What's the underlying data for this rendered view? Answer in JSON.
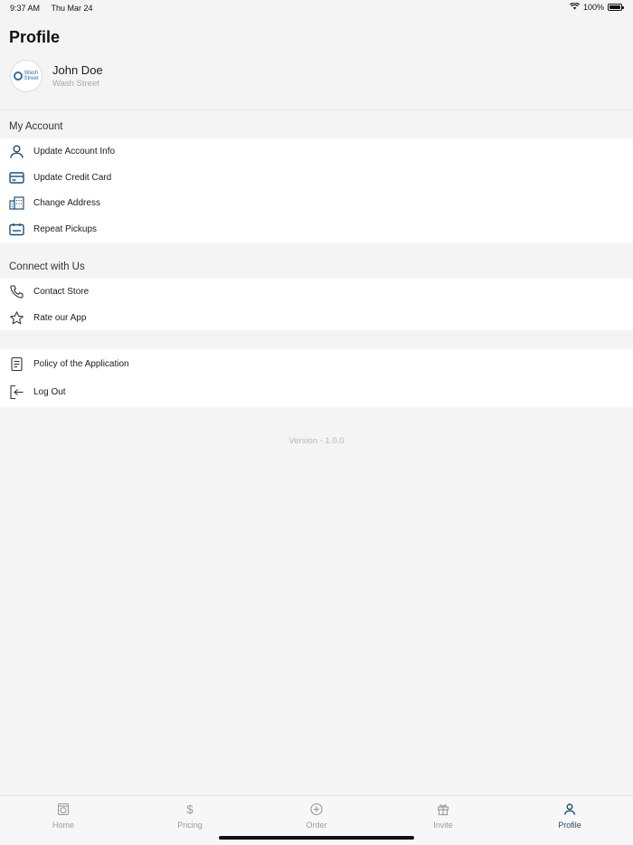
{
  "status_bar": {
    "time": "9:37 AM",
    "date": "Thu Mar 24",
    "battery": "100%"
  },
  "header": {
    "title": "Profile"
  },
  "profile": {
    "name": "John Doe",
    "subtitle": "Wash Street",
    "logo_text_line1": "Wash",
    "logo_text_line2": "Street"
  },
  "my_account": {
    "title": "My Account",
    "items": [
      {
        "label": "Update Account Info",
        "icon": "user-icon"
      },
      {
        "label": "Update Credit Card",
        "icon": "credit-card-icon"
      },
      {
        "label": "Change Address",
        "icon": "building-icon"
      },
      {
        "label": "Repeat Pickups",
        "icon": "calendar-icon"
      }
    ]
  },
  "connect": {
    "title": "Connect with Us",
    "items": [
      {
        "label": "Contact Store",
        "icon": "phone-icon"
      },
      {
        "label": "Rate our App",
        "icon": "star-icon"
      }
    ]
  },
  "other": {
    "items": [
      {
        "label": "Policy of the Application",
        "icon": "document-icon"
      },
      {
        "label": "Log Out",
        "icon": "logout-icon"
      }
    ]
  },
  "version": "Version - 1.0.0",
  "tabs": [
    {
      "label": "Home",
      "icon": "washer-icon",
      "active": false
    },
    {
      "label": "Pricing",
      "icon": "dollar-icon",
      "active": false
    },
    {
      "label": "Order",
      "icon": "plus-circle-icon",
      "active": false
    },
    {
      "label": "Invite",
      "icon": "gift-icon",
      "active": false
    },
    {
      "label": "Profile",
      "icon": "user-icon",
      "active": true
    }
  ],
  "colors": {
    "accent": "#1d4f7a",
    "icon_blue": "#1d4f7a",
    "inactive": "#9a9a9a",
    "background": "#f4f4f4"
  }
}
